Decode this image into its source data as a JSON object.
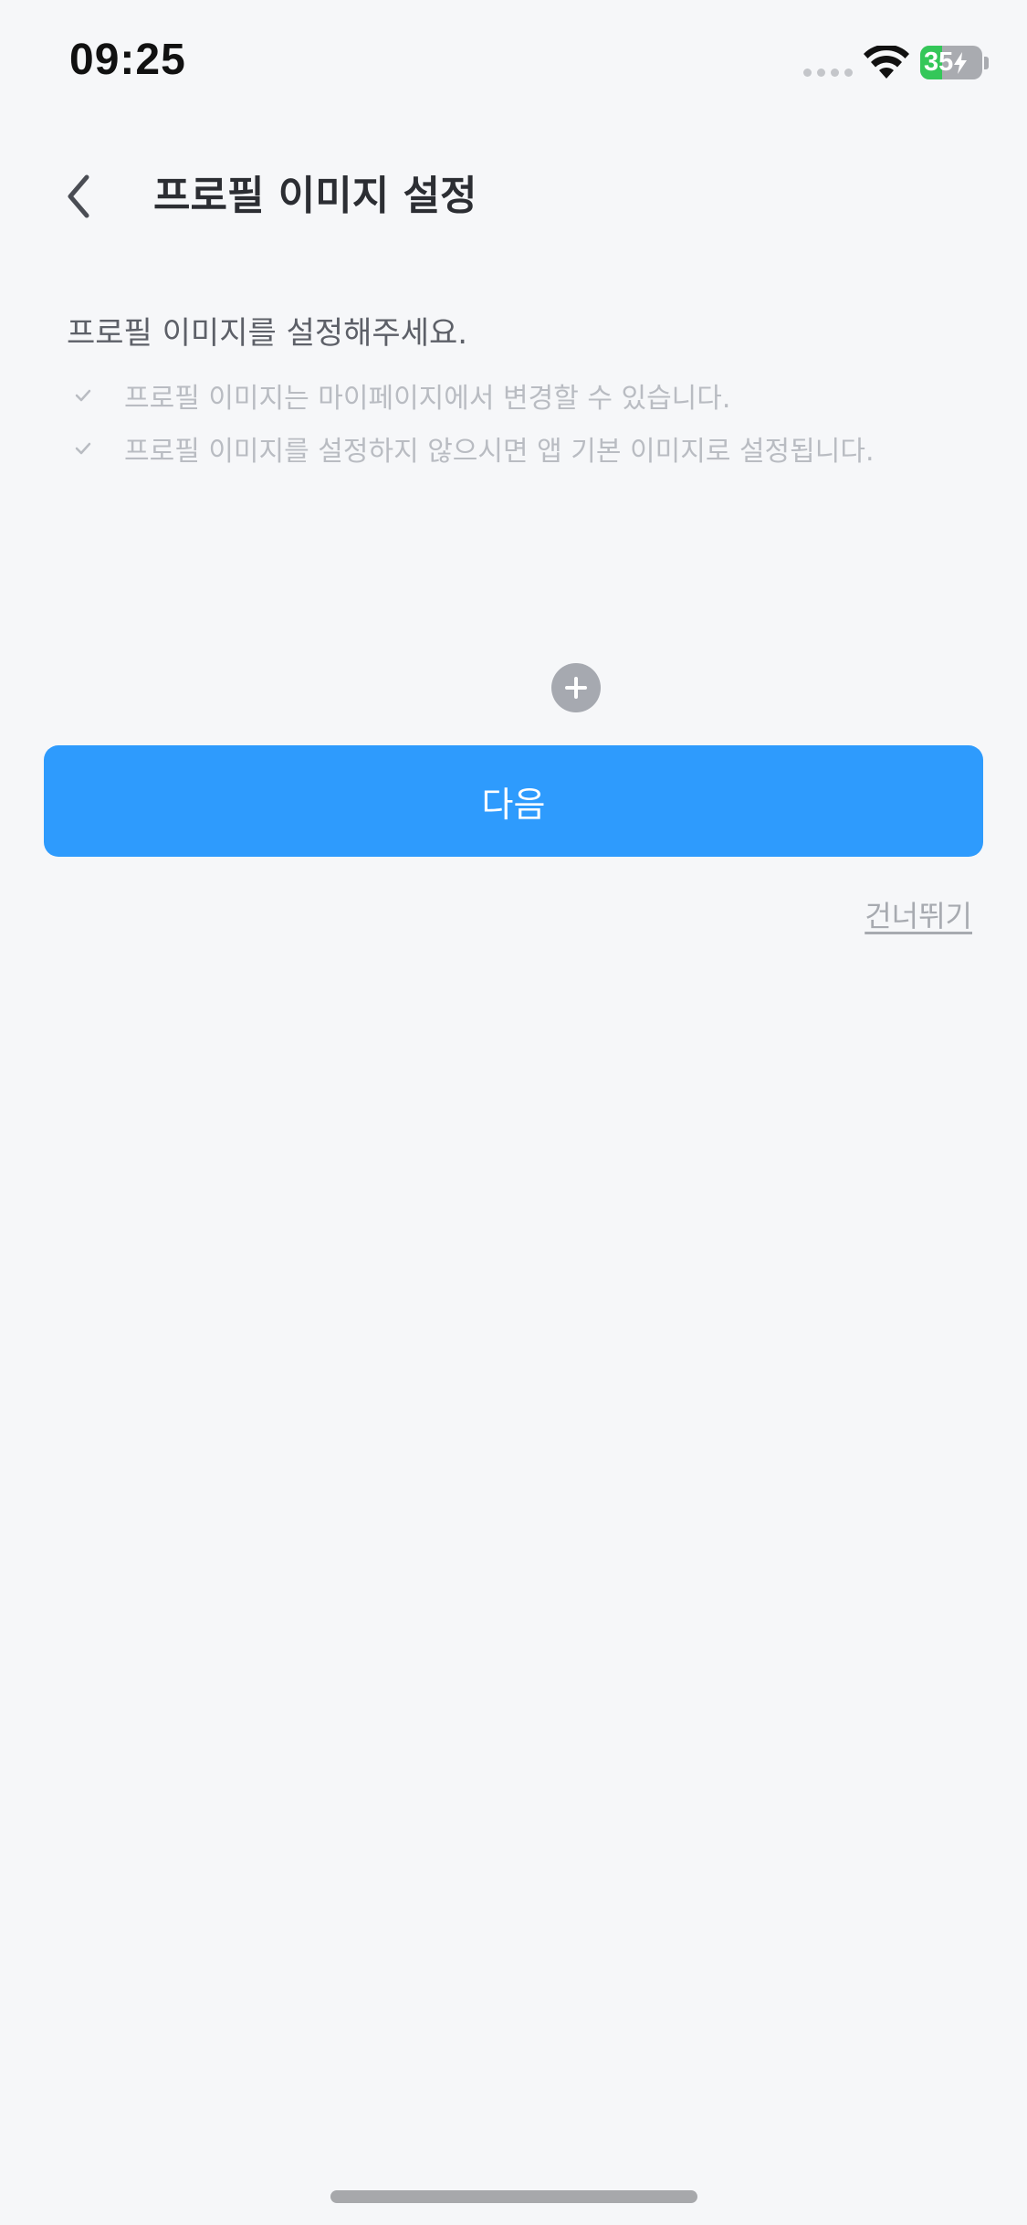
{
  "status_bar": {
    "time": "09:25",
    "battery_text": "35",
    "battery_level": 0.35,
    "battery_color": "#34c759"
  },
  "nav": {
    "back_icon": "chevron-left-icon",
    "title": "프로필 이미지 설정"
  },
  "content": {
    "intro": "프로필 이미지를 설정해주세요.",
    "notes": [
      "프로필 이미지는 마이페이지에서 변경할 수 있습니다.",
      "프로필 이미지를 설정하지 않으시면 앱 기본 이미지로 설정됩니다."
    ],
    "check_icon": "check-icon",
    "add_icon": "plus-icon"
  },
  "actions": {
    "next_label": "다음",
    "next_color": "#2e9bfd",
    "skip_label": "건너뛰기"
  }
}
